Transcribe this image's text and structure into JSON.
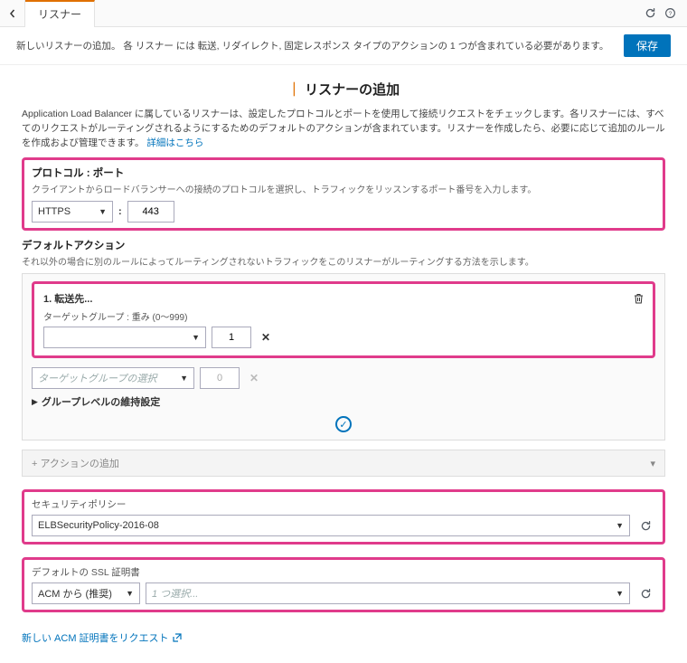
{
  "topbar": {
    "tab_label": "リスナー"
  },
  "info": {
    "text": "新しいリスナーの追加。 各 リスナー には 転送, リダイレクト, 固定レスポンス タイプのアクションの 1 つが含まれている必要があります。",
    "save_label": "保存"
  },
  "page": {
    "title": "リスナーの追加",
    "desc1": "Application Load Balancer に属しているリスナーは、設定したプロトコルとポートを使用して接続リクエストをチェックします。各リスナーには、すべてのリクエストがルーティングされるようにするためのデフォルトのアクションが含まれています。リスナーを作成したら、必要に応じて追加のルールを作成および管理できます。",
    "learn_more": "詳細はこちら"
  },
  "protocol": {
    "title": "プロトコル : ポート",
    "desc": "クライアントからロードバランサーへの接続のプロトコルを選択し、トラフィックをリッスンするポート番号を入力します。",
    "value": "HTTPS",
    "port": "443"
  },
  "default_action": {
    "title": "デフォルトアクション",
    "desc": "それ以外の場合に別のルールによってルーティングされないトラフィックをこのリスナーがルーティングする方法を示します。",
    "forward": {
      "head": "1. 転送先...",
      "tg_label": "ターゲットグループ : 重み (0〜999)",
      "weight": "1"
    },
    "tg_placeholder": "ターゲットグループの選択",
    "tg_weight2": "0",
    "group_settings": "グループレベルの維持設定",
    "add_action": "+  アクションの追加"
  },
  "security_policy": {
    "title": "セキュリティポリシー",
    "value": "ELBSecurityPolicy-2016-08"
  },
  "ssl": {
    "title": "デフォルトの SSL 証明書",
    "source": "ACM から (推奨)",
    "placeholder": "1 つ選択..."
  },
  "request_acm": "新しい ACM 証明書をリクエスト"
}
